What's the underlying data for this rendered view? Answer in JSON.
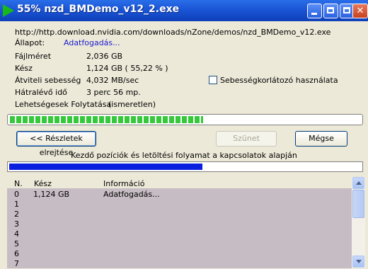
{
  "window": {
    "title": "55% nzd_BMDemo_v12_2.exe"
  },
  "download": {
    "url": "http://http.download.nvidia.com/downloads/nZone/demos/nzd_BMDemo_v12.exe",
    "status_label": "Állapot:",
    "status_value": "Adatfogadás...",
    "rows": [
      {
        "label": "Fájlméret",
        "value": "2,036  GB"
      },
      {
        "label": "Kész",
        "value": "1,124  GB  ( 55,22 % )"
      },
      {
        "label": "Átviteli sebesség",
        "value": "4,032  MB/sec"
      },
      {
        "label": "Hátralévő idő",
        "value": "3 perc 56 mp."
      }
    ],
    "continuation_label": "Lehetségesek Folytatása",
    "continuation_value": "(ismeretlen)",
    "speed_limit_label": "Sebességkorlátozó használata",
    "speed_limit_checked": false,
    "progress_fraction": 0.5522
  },
  "buttons": {
    "details": "<< Részletek elrejtése",
    "pause": "Szünet",
    "cancel": "Mégse"
  },
  "connections": {
    "caption": "Kezdő pozíciók és letöltési folyamat a kapcsolatok alapján",
    "progress_fraction": 0.55,
    "header": {
      "n": "N.",
      "kesz": "Kész",
      "info": "Információ"
    },
    "rows": [
      {
        "n": "0",
        "kesz": "1,124  GB",
        "info": "Adatfogadás..."
      },
      {
        "n": "1",
        "kesz": "",
        "info": ""
      },
      {
        "n": "2",
        "kesz": "",
        "info": ""
      },
      {
        "n": "3",
        "kesz": "",
        "info": ""
      },
      {
        "n": "4",
        "kesz": "",
        "info": ""
      },
      {
        "n": "5",
        "kesz": "",
        "info": ""
      },
      {
        "n": "6",
        "kesz": "",
        "info": ""
      },
      {
        "n": "7",
        "kesz": "",
        "info": ""
      }
    ]
  },
  "colors": {
    "titlebar": "#1a55d6",
    "progress_green": "#35c83a",
    "progress_blue": "#0a1ee0",
    "list_bg": "#c6bcc3",
    "status_link": "#1a1acc"
  }
}
